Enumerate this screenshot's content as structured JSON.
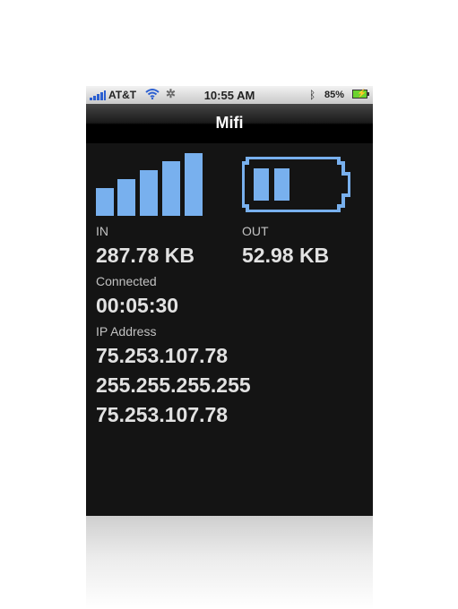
{
  "status_bar": {
    "carrier": "AT&T",
    "time": "10:55 AM",
    "battery_percent": "85%",
    "wifi_icon": "wifi-icon",
    "activity_icon": "activity-spinner-icon",
    "bluetooth_icon": "bluetooth-icon"
  },
  "nav": {
    "title": "Mifi"
  },
  "signal_strength_icon": "signal-bars-icon",
  "battery_icon": "battery-level-icon",
  "battery_level_segments": "2 of 5",
  "stats": {
    "in_label": "IN",
    "in_value": "287.78 KB",
    "out_label": "OUT",
    "out_value": "52.98 KB",
    "connected_label": "Connected",
    "connected_value": "00:05:30",
    "ip_label": "IP Address",
    "ip_values": [
      "75.253.107.78",
      "255.255.255.255",
      "75.253.107.78"
    ]
  },
  "colors": {
    "accent": "#78b0ee",
    "background": "#141414",
    "value_text": "#e2e2e2"
  }
}
